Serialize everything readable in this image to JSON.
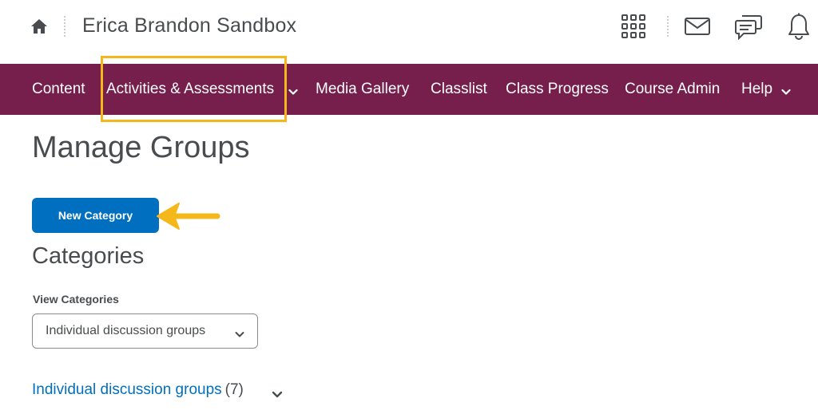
{
  "header": {
    "course_title": "Erica Brandon Sandbox",
    "icons": [
      "home-icon",
      "grid-icon",
      "mail-icon",
      "chat-icon",
      "bell-icon"
    ]
  },
  "nav": {
    "items": [
      {
        "label": "Content"
      },
      {
        "label": "Activities & Assessments",
        "has_dropdown": true,
        "highlighted": true
      },
      {
        "label": "Media Gallery"
      },
      {
        "label": "Classlist"
      },
      {
        "label": "Class Progress"
      },
      {
        "label": "Course Admin"
      },
      {
        "label": "Help",
        "has_dropdown": true
      }
    ]
  },
  "main": {
    "page_title": "Manage Groups",
    "new_category_label": "New Category",
    "categories_title": "Categories",
    "view_categories_label": "View Categories",
    "view_categories_value": "Individual discussion groups",
    "group": {
      "name": "Individual discussion groups",
      "count": "(7)"
    }
  },
  "colors": {
    "navbar": "#761e4c",
    "primary_button": "#006fbf",
    "link": "#006fbf",
    "annotation": "#f5b81b",
    "text": "#494c4e"
  }
}
